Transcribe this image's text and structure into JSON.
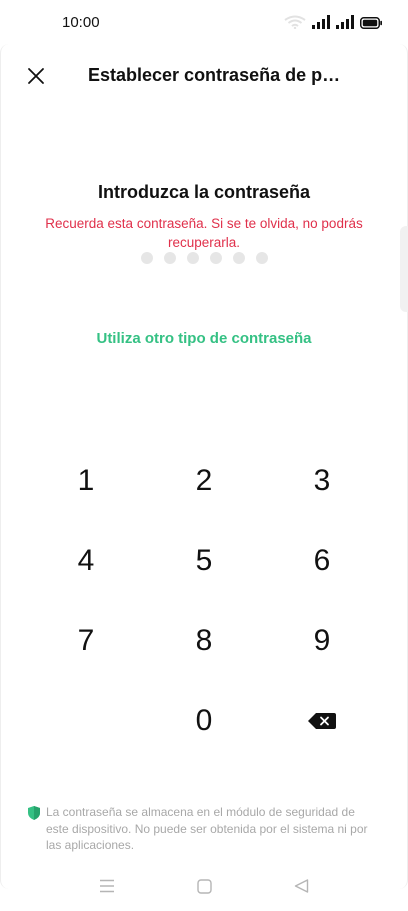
{
  "status_bar": {
    "time": "10:00",
    "icons": [
      "wifi-icon",
      "signal-icon",
      "signal-icon",
      "battery-icon"
    ]
  },
  "header": {
    "close_icon": "close-icon",
    "title": "Establecer contraseña de pant…"
  },
  "prompt": {
    "title": "Introduzca la contraseña",
    "warning": "Recuerda esta contraseña. Si se te olvida, no podrás recuperarla.",
    "pin_length": 6,
    "pin_entered": 0
  },
  "alt_link": "Utiliza otro tipo de contraseña",
  "keypad": {
    "keys": [
      "1",
      "2",
      "3",
      "4",
      "5",
      "6",
      "7",
      "8",
      "9",
      "0"
    ],
    "delete_icon": "backspace-icon"
  },
  "security_note": {
    "icon": "shield-icon",
    "text": "La contraseña se almacena en el módulo de seguridad de este dispositivo. No puede ser obtenida por el sistema ni por las aplicaciones."
  },
  "nav_bar": {
    "icons": [
      "menu-icon",
      "home-icon",
      "back-icon"
    ]
  },
  "colors": {
    "warning": "#e0304b",
    "accent": "#35c184",
    "dot_inactive": "#e6e6e6",
    "note_text": "#a8a8a8"
  }
}
